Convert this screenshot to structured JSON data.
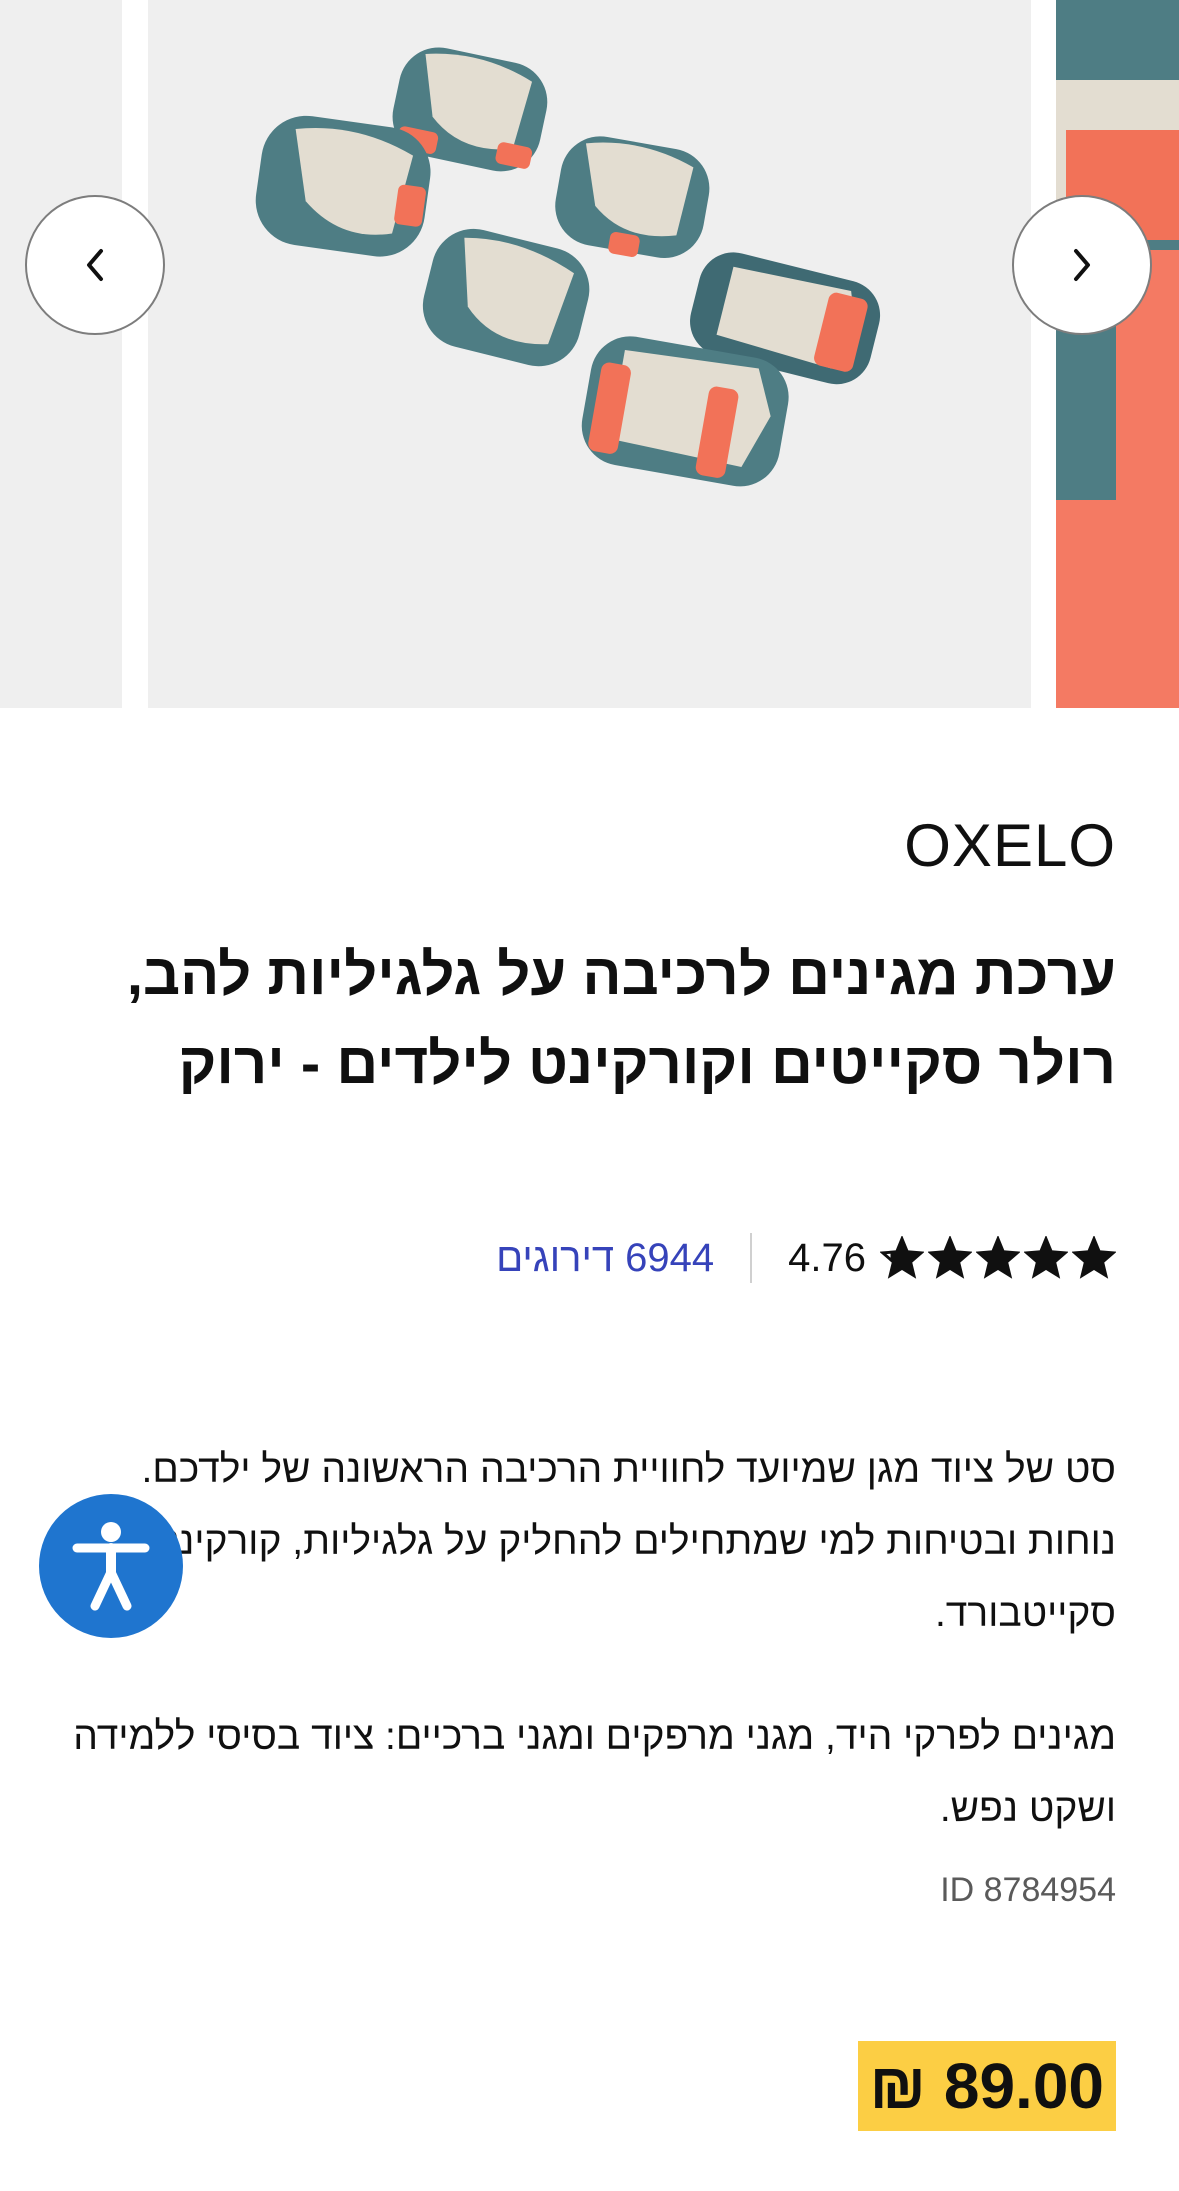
{
  "gallery": {
    "prev_icon": "chevron-left-icon",
    "next_icon": "chevron-right-icon",
    "image_subject": "kids protective gear set"
  },
  "product": {
    "brand": "OXELO",
    "title": "ערכת מגינים לרכיבה על גלגיליות להב, רולר סקייטים וקורקינט לילדים - ירוק",
    "rating": {
      "value": "4.76",
      "stars": 4.76,
      "max_stars": 5,
      "reviews_count": "6944",
      "reviews_label": "דירוגים"
    },
    "description": [
      "סט של ציוד מגן שמיועד לחוויית הרכיבה הראשונה של ילדכם. נוחות ובטיחות למי שמתחילים להחליק על גלגיליות, קורקינט או סקייטבורד.",
      "מגינים לפרקי היד, מגני מרפקים ומגני ברכיים: ציוד בסיסי ללמידה ושקט נפש."
    ],
    "product_id": "ID 8784954",
    "price": "₪ 89.00"
  },
  "accessibility": {
    "icon": "accessibility-icon"
  },
  "colors": {
    "price_highlight": "#fcce44",
    "link": "#3643ba",
    "accessibility_button": "#1f75cf",
    "pad_teal": "#4e7d84",
    "pad_cream": "#e3ddd1",
    "strap_orange": "#f27258"
  }
}
